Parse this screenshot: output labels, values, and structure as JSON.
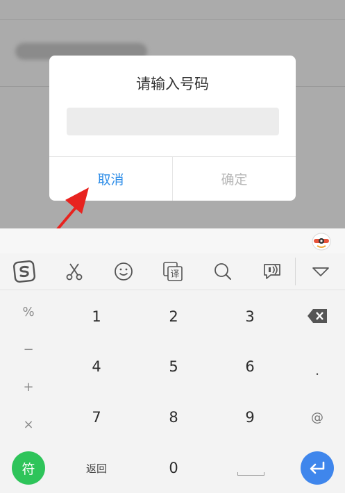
{
  "dialog": {
    "title": "请输入号码",
    "input_value": "",
    "cancel_label": "取消",
    "confirm_label": "确定"
  },
  "colors": {
    "cancel": "#2f8ee8",
    "confirm_disabled": "#b8b8b8",
    "symbol_button": "#2ec45a",
    "enter_button": "#3f86ec",
    "arrow": "#e8231f"
  },
  "keyboard": {
    "toolbar_icons": [
      "sogou-logo-icon",
      "scissors-icon",
      "emoji-icon",
      "translate-icon",
      "search-icon",
      "voice-chat-icon",
      "collapse-keyboard-icon"
    ],
    "translate_glyph": "译",
    "left_symbols": [
      "%",
      "−",
      "+",
      "×"
    ],
    "digits": {
      "k1": "1",
      "k2": "2",
      "k3": "3",
      "k4": "4",
      "k5": "5",
      "k6": "6",
      "k7": "7",
      "k8": "8",
      "k9": "9",
      "k0": "0"
    },
    "right_keys": {
      "dot": ".",
      "at": "@"
    },
    "symbol_label": "符",
    "back_label": "返回"
  }
}
